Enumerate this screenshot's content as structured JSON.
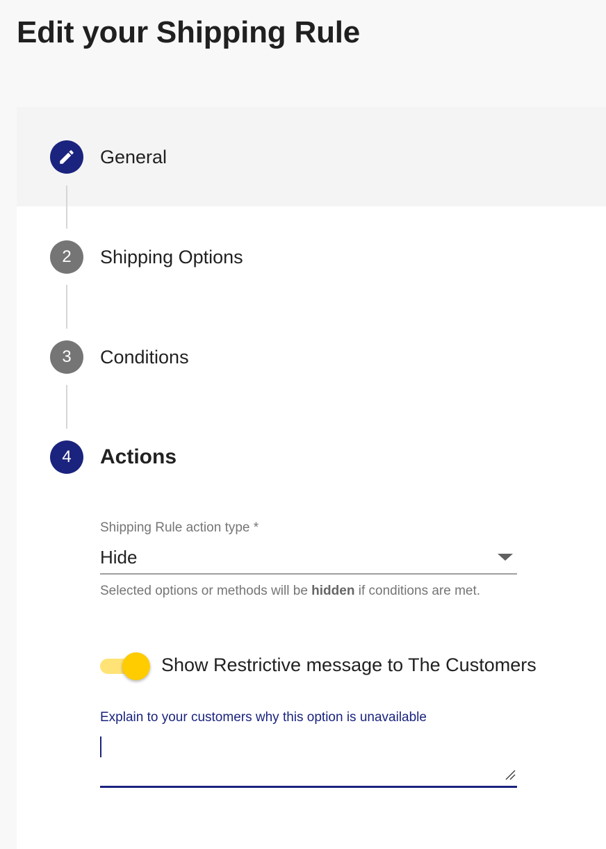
{
  "page": {
    "title": "Edit your Shipping Rule"
  },
  "steps": [
    {
      "number": "",
      "label": "General",
      "icon": "pencil-icon",
      "state": "done"
    },
    {
      "number": "2",
      "label": "Shipping Options",
      "state": "idle"
    },
    {
      "number": "3",
      "label": "Conditions",
      "state": "idle"
    },
    {
      "number": "4",
      "label": "Actions",
      "state": "current"
    }
  ],
  "actions": {
    "action_type_label": "Shipping Rule action type *",
    "action_type_value": "Hide",
    "hint_prefix": "Selected options or methods will be ",
    "hint_bold": "hidden",
    "hint_suffix": " if conditions are met.",
    "toggle_on": true,
    "toggle_label": "Show Restrictive message to The Customers",
    "message_label": "Explain to your customers why this option is unavailable",
    "message_value": ""
  },
  "colors": {
    "primary": "#1a237e",
    "idle_step": "#757575",
    "toggle_thumb": "#ffcc00",
    "toggle_track": "#ffe377"
  }
}
